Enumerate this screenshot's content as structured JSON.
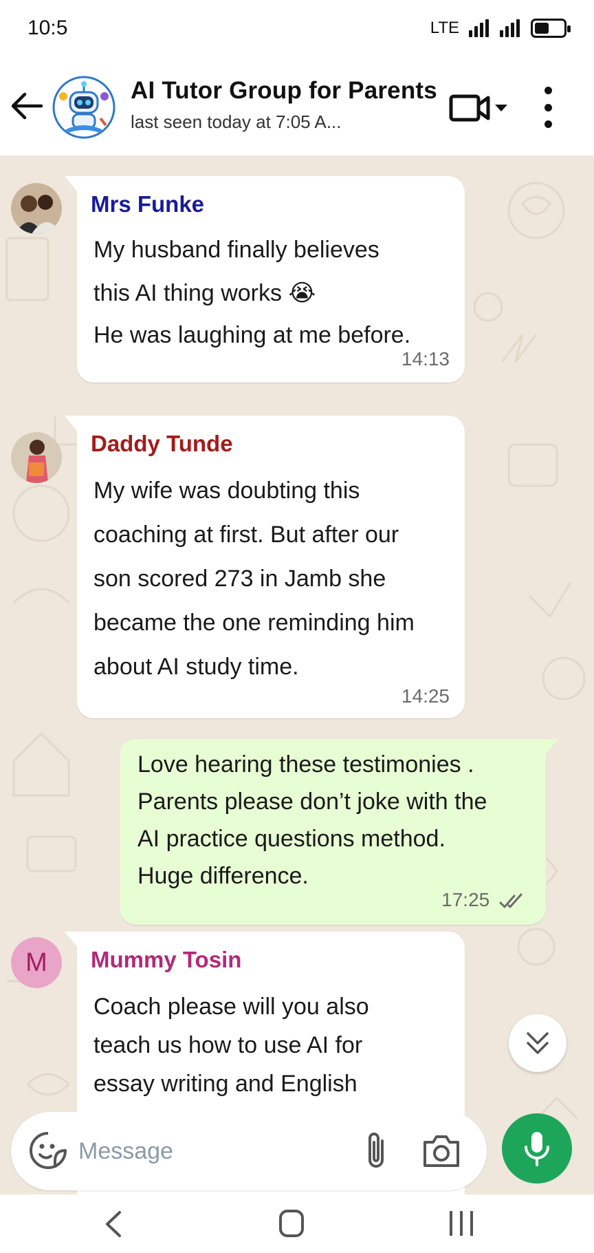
{
  "status_bar": {
    "time": "10:5",
    "network": "LTE"
  },
  "header": {
    "title": "AI Tutor Group for Parents",
    "subtitle": "last seen today at 7:05 A..."
  },
  "messages": [
    {
      "sender": "Mrs Funke",
      "sender_color": "#1a1a9c",
      "lines": [
        "My husband finally believes",
        "this AI thing works 😭",
        "He was laughing at me before."
      ],
      "time": "14:13"
    },
    {
      "sender": "Daddy Tunde",
      "sender_color": "#a31b1b",
      "lines": [
        "My wife was doubting this",
        "coaching at first. But after our",
        "son scored 273 in Jamb she",
        "became the one reminding him",
        "about AI study time."
      ],
      "time": "14:25"
    },
    {
      "lines": [
        "Love hearing these testimonies .",
        "Parents please don’t joke with the",
        "AI practice questions method.",
        "Huge difference."
      ],
      "time": "17:25"
    },
    {
      "sender": "Mummy Tosin",
      "sender_color": "#b02a78",
      "avatar_letter": "M",
      "lines": [
        "Coach please will you also",
        "teach us how to use AI for",
        "essay writing and English"
      ]
    }
  ],
  "composer": {
    "placeholder": "Message"
  },
  "colors": {
    "outgoing_bubble": "#e7fdd3",
    "mic_button": "#1da65a",
    "wallpaper": "#efe7dc"
  },
  "icons": [
    "back-arrow-icon",
    "video-call-icon",
    "more-options-icon",
    "sticker-icon",
    "attach-icon",
    "camera-icon",
    "mic-icon",
    "double-chevron-down-icon",
    "read-receipt-ticks-icon"
  ]
}
